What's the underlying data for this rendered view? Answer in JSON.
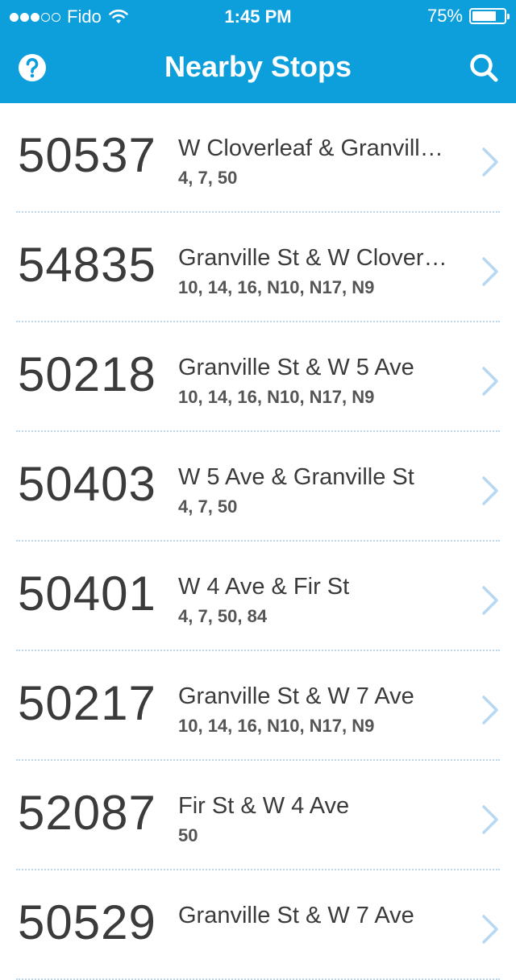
{
  "status_bar": {
    "carrier": "Fido",
    "time": "1:45 PM",
    "battery_text": "75%",
    "battery_level": 0.75,
    "signal_strength": 3,
    "signal_max": 5
  },
  "nav": {
    "title": "Nearby Stops",
    "left_icon": "help-icon",
    "right_icon": "search-icon",
    "color": "#0d9edc"
  },
  "stops": [
    {
      "number": "50537",
      "name": "W Cloverleaf & Granvill…",
      "routes": "4, 7, 50"
    },
    {
      "number": "54835",
      "name": "Granville St & W Clover…",
      "routes": "10, 14, 16, N10, N17, N9"
    },
    {
      "number": "50218",
      "name": "Granville St & W 5 Ave",
      "routes": "10, 14, 16, N10, N17, N9"
    },
    {
      "number": "50403",
      "name": "W 5 Ave & Granville St",
      "routes": "4, 7, 50"
    },
    {
      "number": "50401",
      "name": "W 4 Ave & Fir St",
      "routes": "4, 7, 50, 84"
    },
    {
      "number": "50217",
      "name": "Granville St & W 7 Ave",
      "routes": "10, 14, 16, N10, N17, N9"
    },
    {
      "number": "52087",
      "name": "Fir St & W 4 Ave",
      "routes": "50"
    },
    {
      "number": "50529",
      "name": "Granville St & W 7 Ave",
      "routes": ""
    }
  ]
}
